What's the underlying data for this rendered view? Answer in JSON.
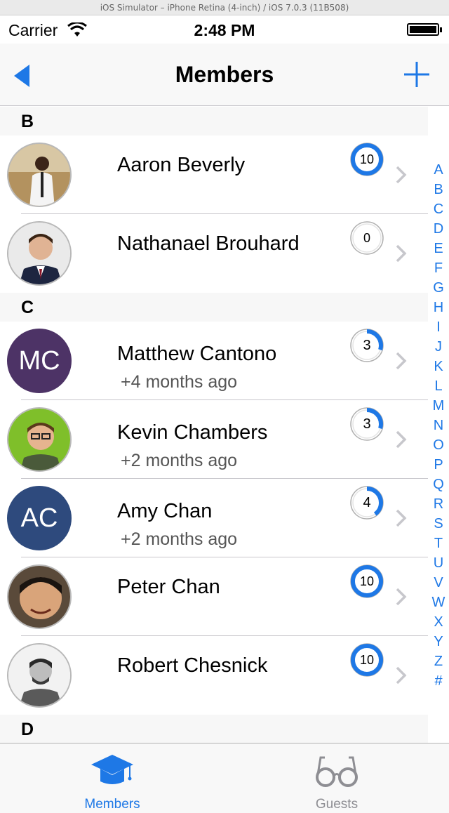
{
  "simulator_title": "iOS Simulator – iPhone Retina (4-inch) / iOS 7.0.3 (11B508)",
  "status": {
    "carrier": "Carrier",
    "time": "2:48 PM"
  },
  "nav": {
    "title": "Members"
  },
  "sections": [
    {
      "header": "B",
      "rows": [
        {
          "name": "Aaron Beverly",
          "sub": "",
          "badge": "10",
          "progress": 1.0
        },
        {
          "name": "Nathanael Brouhard",
          "sub": "",
          "badge": "0",
          "progress": 0.0
        }
      ]
    },
    {
      "header": "C",
      "rows": [
        {
          "name": "Matthew Cantono",
          "sub": "+4 months ago",
          "badge": "3",
          "progress": 0.3,
          "initials": "MC",
          "avatar_color": "#4d3366"
        },
        {
          "name": "Kevin Chambers",
          "sub": "+2 months ago",
          "badge": "3",
          "progress": 0.3
        },
        {
          "name": "Amy Chan",
          "sub": "+2 months ago",
          "badge": "4",
          "progress": 0.4,
          "initials": "AC",
          "avatar_color": "#2e4a7d"
        },
        {
          "name": "Peter Chan",
          "sub": "",
          "badge": "10",
          "progress": 1.0
        },
        {
          "name": "Robert Chesnick",
          "sub": "",
          "badge": "10",
          "progress": 1.0
        }
      ]
    },
    {
      "header": "D",
      "rows": []
    }
  ],
  "index_letters": [
    "A",
    "B",
    "C",
    "D",
    "E",
    "F",
    "G",
    "H",
    "I",
    "J",
    "K",
    "L",
    "M",
    "N",
    "O",
    "P",
    "Q",
    "R",
    "S",
    "T",
    "U",
    "V",
    "W",
    "X",
    "Y",
    "Z",
    "#"
  ],
  "tabs": [
    {
      "label": "Members",
      "icon": "graduation-cap-icon",
      "active": true
    },
    {
      "label": "Guests",
      "icon": "glasses-icon",
      "active": false
    }
  ],
  "colors": {
    "accent": "#1e78e6",
    "separator": "#c8c7cc",
    "section_bg": "#f7f7f7"
  }
}
